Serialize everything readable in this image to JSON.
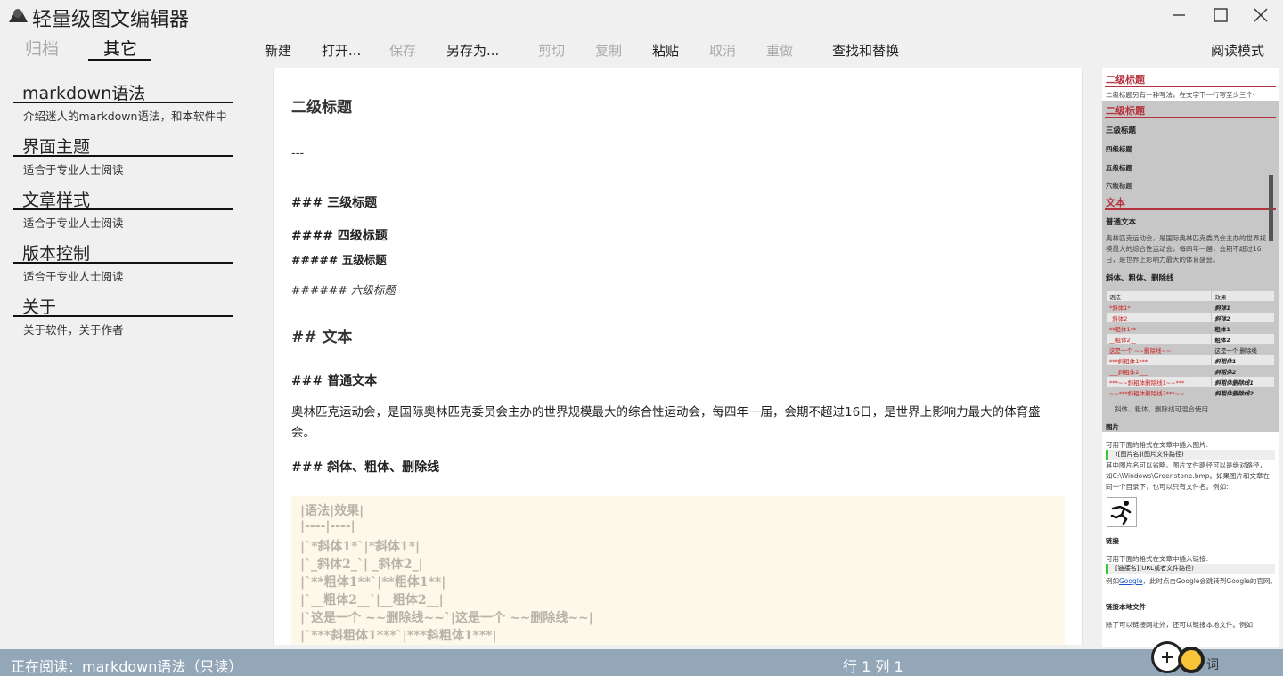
{
  "window": {
    "title": "轻量级图文编辑器"
  },
  "sidebar": {
    "tabs": [
      {
        "label": "归档",
        "active": false
      },
      {
        "label": "其它",
        "active": true
      }
    ],
    "items": [
      {
        "title": "markdown语法",
        "desc": "介绍迷人的markdown语法，和本软件中"
      },
      {
        "title": "界面主题",
        "desc": "适合于专业人士阅读"
      },
      {
        "title": "文章样式",
        "desc": "适合于专业人士阅读"
      },
      {
        "title": "版本控制",
        "desc": "适合于专业人士阅读"
      },
      {
        "title": "关于",
        "desc": "关于软件，关于作者"
      }
    ]
  },
  "toolbar": {
    "new": "新建",
    "open": "打开...",
    "save": "保存",
    "save_as": "另存为...",
    "cut": "剪切",
    "copy": "复制",
    "paste": "粘贴",
    "undo": "取消",
    "redo": "重做",
    "find_replace": "查找和替换",
    "reading_mode": "阅读模式"
  },
  "editor": {
    "lines": {
      "h2": "二级标题",
      "hr": "---",
      "h3": "### 三级标题",
      "h4": "#### 四级标题",
      "h5": "##### 五级标题",
      "h6": "###### 六级标题",
      "h2_text": "## 文本",
      "h3_plain": "### 普通文本",
      "paragraph": "奥林匹克运动会，是国际奥林匹克委员会主办的世界规模最大的综合性运动会，每四年一届，会期不超过16日，是世界上影响力最大的体育盛会。",
      "h3_styles": "### 斜体、粗体、删除线"
    },
    "code_lines": [
      "|语法|效果|",
      "|----|----|",
      "|`*斜体1*`|*斜体1*|",
      "|`_斜体2_`| _斜体2_|",
      "|`**粗体1**`|**粗体1**|",
      "|`__粗体2__`|__粗体2__|",
      "|`这是一个 ~~删除线~~`|这是一个 ~~删除线~~|",
      "|`***斜粗体1***`|***斜粗体1***|"
    ]
  },
  "preview": {
    "h2_a": "二级标题",
    "sub_a": "二级标题另有一种写法，在文字下一行写至少三个-",
    "h2_b": "二级标题",
    "h3": "三级标题",
    "h4": "四级标题",
    "h5": "五级标题",
    "h6": "六级标题",
    "text_heading": "文本",
    "plain_heading": "普通文本",
    "plain_para": "奥林匹克运动会，是国际奥林匹克委员会主办的世界规模最大的综合性运动会，每四年一届，会期不超过16日，是世界上影响力最大的体育盛会。",
    "styles_heading": "斜体、粗体、删除线",
    "table_header": [
      "语法",
      "效果"
    ],
    "table_rows": [
      [
        "*斜体1*",
        "斜体1"
      ],
      [
        "_斜体2_",
        "斜体2"
      ],
      [
        "**粗体1**",
        "粗体1"
      ],
      [
        "__粗体2__",
        "粗体2"
      ],
      [
        "这是一个 ~~删除线~~",
        "这是一个 删除线"
      ],
      [
        "***斜粗体1***",
        "斜粗体1"
      ],
      [
        "___斜粗体2___",
        "斜粗体2"
      ],
      [
        "***~~斜粗体删除线1~~***",
        "斜粗体删除线1"
      ],
      [
        "~~***斜粗体删除线2***~~",
        "斜粗体删除线2"
      ]
    ],
    "styles_note": "斜体、粗体、删除线可混合使用",
    "image_heading": "图片",
    "image_intro": "可用下面的格式在文章中插入图片:",
    "image_code": "![图片名](图片文件路径)",
    "image_para": "其中图片名可以省略。图片文件路径可以是绝对路径，如C:\\Windows\\Greenstone.bmp。如果图片和文章在同一个目录下，也可以只有文件名。例如:",
    "link_heading": "链接",
    "link_intro": "可用下面的格式在文章中插入链接:",
    "link_code": "[链接名](URL或者文件路径)",
    "link_example_prefix": "例如",
    "link_example_link": "Google",
    "link_example_suffix": "，此时点击Google会跳转到Google的官网。",
    "local_heading": "链接本地文件",
    "local_para": "除了可以链接网址外，还可以链接本地文件。例如"
  },
  "status": {
    "reading": "正在阅读：markdown语法（只读）",
    "position": "行 1 列 1",
    "right_text": "词"
  },
  "colors": {
    "statusbar": "#93a7b9",
    "preview_heading": "#b5323c",
    "code_bg": "#fdf8ea"
  }
}
